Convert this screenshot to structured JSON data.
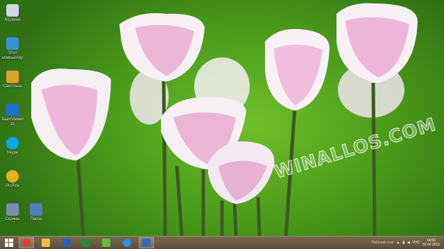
{
  "desktop_icons": [
    {
      "name": "recycle-bin-icon",
      "label": "Корзина",
      "color": "#cfd8e3"
    },
    {
      "name": "computer-icon",
      "label": "Этот компьютер",
      "color": "#3a8fd8"
    },
    {
      "name": "user-folder-icon",
      "label": "Светлана",
      "color": "#e0a030"
    },
    {
      "name": "teamviewer-icon",
      "label": "TeamViewer 10",
      "color": "#1d6fd1"
    },
    {
      "name": "skype-icon",
      "label": "Skype",
      "color": "#00a9f0"
    },
    {
      "name": "picpick-icon",
      "label": "PicPick",
      "color": "#e8b020"
    },
    {
      "name": "screenshots-icon",
      "label": "Скрины",
      "color": "#7a8fb0"
    },
    {
      "name": "folder-icon",
      "label": "Папка",
      "color": "#4f7ec4"
    }
  ],
  "watermark": "WINALLOS.COM",
  "taskbar": {
    "start_icon": "windows-start-icon",
    "pinned": [
      {
        "name": "chrome-icon",
        "color": "#e04030"
      },
      {
        "name": "file-explorer-icon",
        "color": "#f0c040"
      },
      {
        "name": "word-icon",
        "color": "#2b5fb4"
      },
      {
        "name": "excel-icon",
        "color": "#1e8a3e"
      },
      {
        "name": "spreadsheet-icon",
        "color": "#5fbf3a"
      },
      {
        "name": "internet-explorer-icon",
        "color": "#2a8fe0"
      },
      {
        "name": "outlook-icon",
        "color": "#2a6fc0"
      }
    ]
  },
  "tray": {
    "hidden_text": "Рабочий стол",
    "language": "РУС",
    "time": "14:53",
    "date": "02.04.2015"
  }
}
